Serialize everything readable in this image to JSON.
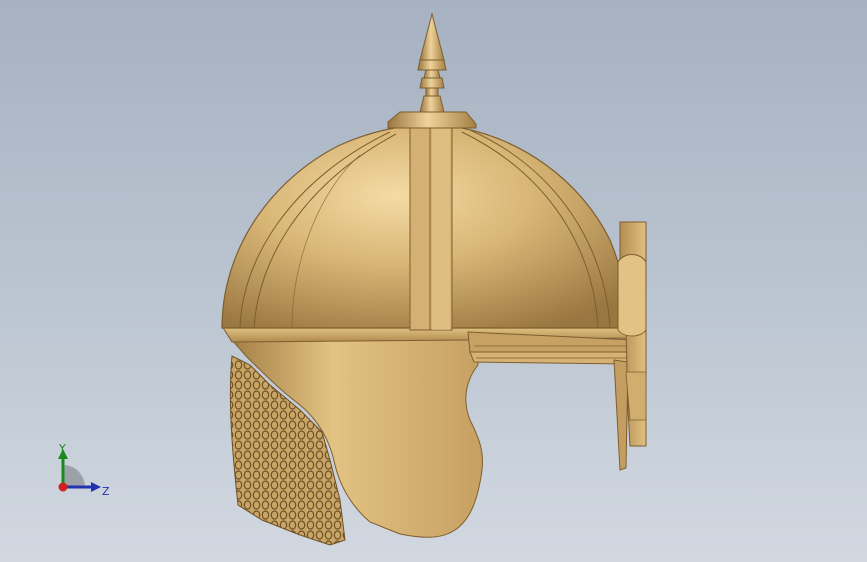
{
  "viewport": {
    "background_top": "#a6b1c1",
    "background_bottom": "#d2d8e0"
  },
  "model": {
    "name": "helmet",
    "color_base": "#c9a566",
    "color_light": "#f0d49a",
    "color_dark": "#8e6c36"
  },
  "triad": {
    "y_label": "Y",
    "z_label": "Z",
    "y_color": "#1a8a1a",
    "z_color": "#2233b0",
    "origin_color": "#d02020"
  }
}
